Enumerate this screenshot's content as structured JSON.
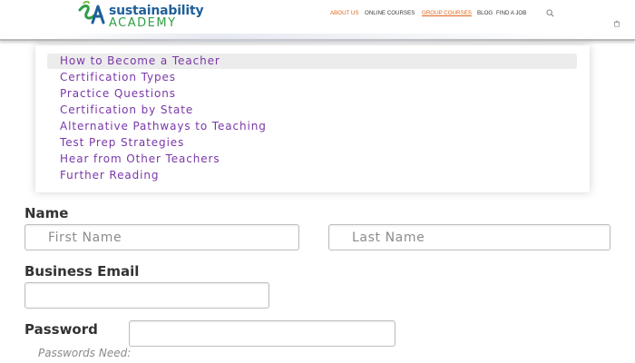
{
  "header": {
    "logo": {
      "line1": "sustainability",
      "line2": "ACADEMY",
      "mark": "SA"
    },
    "nav": [
      {
        "label": "ABOUT US",
        "color": "#e2661d",
        "underline": false
      },
      {
        "label": "ONLINE COURSES",
        "color": "#3a3a3a",
        "underline": false
      },
      {
        "label": "GROUP COURSES",
        "color": "#e2661d",
        "underline": true
      },
      {
        "label": "BLOG",
        "color": "#3a3a3a",
        "underline": false
      },
      {
        "label": "FIND A JOB",
        "color": "#3a3a3a",
        "underline": false
      }
    ],
    "icons": [
      "search-icon",
      "cart-icon"
    ]
  },
  "menu": {
    "items": [
      "How to Become a Teacher",
      "Certification Types",
      "Practice Questions",
      "Certification by State",
      "Alternative Pathways to Teaching",
      "Test Prep Strategies",
      "Hear from Other Teachers",
      "Further Reading"
    ],
    "active_index": 0,
    "text_color": "#7a37a8"
  },
  "form": {
    "name_label": "Name",
    "first_name_placeholder": "First Name",
    "last_name_placeholder": "Last Name",
    "email_label": "Business Email",
    "email_value": "",
    "password_label": "Password",
    "password_value": "",
    "password_hint": "Passwords Need:"
  }
}
